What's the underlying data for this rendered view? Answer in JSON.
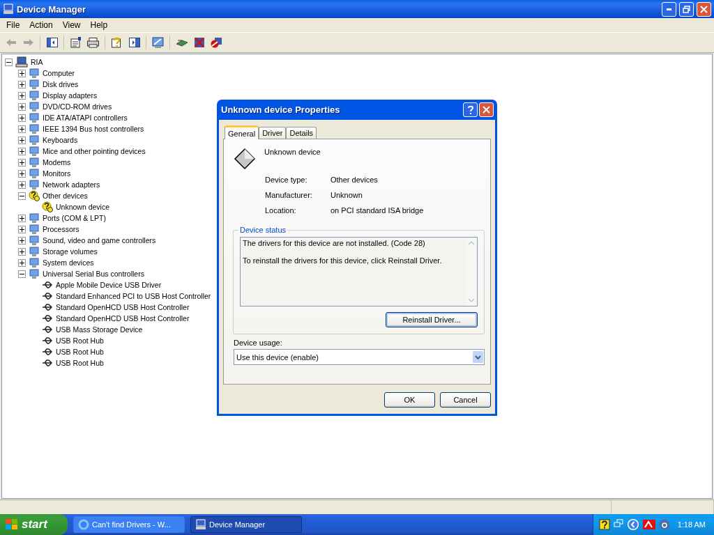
{
  "window": {
    "title": "Device Manager"
  },
  "menu": [
    "File",
    "Action",
    "View",
    "Help"
  ],
  "toolbar": [
    {
      "kind": "back",
      "disabled": true
    },
    {
      "kind": "forward",
      "disabled": true
    },
    {
      "kind": "sep"
    },
    {
      "kind": "tree"
    },
    {
      "kind": "sep"
    },
    {
      "kind": "props"
    },
    {
      "kind": "print"
    },
    {
      "kind": "sep"
    },
    {
      "kind": "help"
    },
    {
      "kind": "panel"
    },
    {
      "kind": "sep"
    },
    {
      "kind": "scan"
    },
    {
      "kind": "sep"
    },
    {
      "kind": "update"
    },
    {
      "kind": "uninstall"
    },
    {
      "kind": "disable"
    }
  ],
  "tree": {
    "label": "RIA",
    "expanded": true,
    "children": [
      {
        "label": "Computer",
        "expanded": false,
        "warning": false
      },
      {
        "label": "Disk drives",
        "expanded": false,
        "warning": false
      },
      {
        "label": "Display adapters",
        "expanded": false,
        "warning": false
      },
      {
        "label": "DVD/CD-ROM drives",
        "expanded": false,
        "warning": false
      },
      {
        "label": "IDE ATA/ATAPI controllers",
        "expanded": false,
        "warning": false
      },
      {
        "label": "IEEE 1394 Bus host controllers",
        "expanded": false,
        "warning": false
      },
      {
        "label": "Keyboards",
        "expanded": false,
        "warning": false
      },
      {
        "label": "Mice and other pointing devices",
        "expanded": false,
        "warning": false
      },
      {
        "label": "Modems",
        "expanded": false,
        "warning": false
      },
      {
        "label": "Monitors",
        "expanded": false,
        "warning": false
      },
      {
        "label": "Network adapters",
        "expanded": false,
        "warning": false
      },
      {
        "label": "Other devices",
        "expanded": true,
        "warning": true,
        "children": [
          {
            "label": "Unknown device",
            "warning": true
          }
        ]
      },
      {
        "label": "Ports (COM & LPT)",
        "expanded": false,
        "warning": false
      },
      {
        "label": "Processors",
        "expanded": false,
        "warning": false
      },
      {
        "label": "Sound, video and game controllers",
        "expanded": false,
        "warning": false
      },
      {
        "label": "Storage volumes",
        "expanded": false,
        "warning": false
      },
      {
        "label": "System devices",
        "expanded": false,
        "warning": false
      },
      {
        "label": "Universal Serial Bus controllers",
        "expanded": true,
        "warning": false,
        "children": [
          {
            "label": "Apple Mobile Device USB Driver",
            "warning": false
          },
          {
            "label": "Standard Enhanced PCI to USB Host Controller",
            "warning": false
          },
          {
            "label": "Standard OpenHCD USB Host Controller",
            "warning": false
          },
          {
            "label": "Standard OpenHCD USB Host Controller",
            "warning": false
          },
          {
            "label": "USB Mass Storage Device",
            "warning": false
          },
          {
            "label": "USB Root Hub",
            "warning": false
          },
          {
            "label": "USB Root Hub",
            "warning": false
          },
          {
            "label": "USB Root Hub",
            "warning": false
          }
        ]
      }
    ]
  },
  "dialog": {
    "title": "Unknown device Properties",
    "tabs": [
      {
        "label": "General",
        "selected": true
      },
      {
        "label": "Driver",
        "selected": false
      },
      {
        "label": "Details",
        "selected": false
      }
    ],
    "device_name": "Unknown device",
    "properties": [
      {
        "label": "Device type:",
        "value": "Other devices"
      },
      {
        "label": "Manufacturer:",
        "value": "Unknown"
      },
      {
        "label": "Location:",
        "value": "on PCI standard ISA bridge"
      }
    ],
    "status_group": "Device status",
    "status_lines": [
      "The drivers for this device are not installed. (Code 28)",
      "To reinstall the drivers for this device, click Reinstall Driver."
    ],
    "action_button": "Reinstall Driver...",
    "usage_label": "Device usage:",
    "usage_value": "Use this device (enable)",
    "buttons": [
      "OK",
      "Cancel"
    ]
  },
  "taskbar": {
    "start": "start",
    "tasks": [
      {
        "label": "Can't find Drivers - W...",
        "selected": false
      },
      {
        "label": "Device Manager",
        "selected": true
      }
    ],
    "clock": "1:18 AM"
  }
}
